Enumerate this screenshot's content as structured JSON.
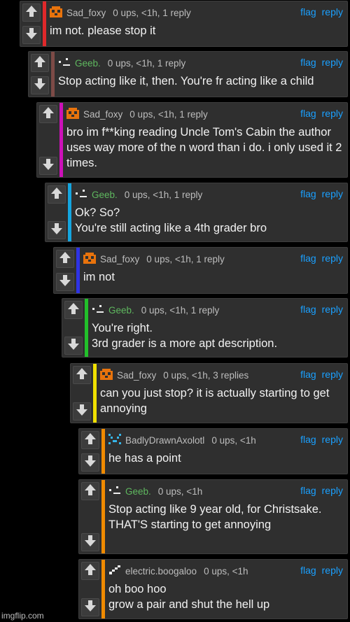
{
  "actions": {
    "flag": "flag",
    "reply": "reply"
  },
  "watermark": "imgflip.com",
  "colors": {
    "background": "#000000",
    "card": "#2f2f2f",
    "link": "#1aa0ff",
    "green_name": "#5fb85f"
  },
  "comments": [
    {
      "user": "Sad_foxy",
      "stats": "0 ups, <1h, 1 reply",
      "text": "im not. please stop it",
      "bar": "#e0282a",
      "avatar": "fox-icon"
    },
    {
      "user": "Geeb.",
      "stats": "0 ups, <1h, 1 reply",
      "text": "Stop acting like it, then. You're fr acting like a child",
      "bar": "#7d4b47",
      "avatar": "face-icon"
    },
    {
      "user": "Sad_foxy",
      "stats": "0 ups, <1h, 1 reply",
      "text": "bro im f**king reading Uncle Tom's Cabin the author uses way more of the n word than i do. i only used it 2 times.",
      "bar": "#cc11b8",
      "avatar": "fox-icon"
    },
    {
      "user": "Geeb.",
      "stats": "0 ups, <1h, 1 reply",
      "text": "Ok? So?\nYou're still acting like a 4th grader bro",
      "bar": "#14a6e0",
      "avatar": "face-icon"
    },
    {
      "user": "Sad_foxy",
      "stats": "0 ups, <1h, 1 reply",
      "text": "im not",
      "bar": "#2e33e6",
      "avatar": "fox-icon"
    },
    {
      "user": "Geeb.",
      "stats": "0 ups, <1h, 1 reply",
      "text": "You're right.\n3rd grader is a more apt description.",
      "bar": "#22c02a",
      "avatar": "face-icon"
    },
    {
      "user": "Sad_foxy",
      "stats": "0 ups, <1h, 3 replies",
      "text": "can you just stop? it is actually starting to get annoying",
      "bar": "#f0e000",
      "avatar": "fox-icon"
    },
    {
      "user": "BadlyDrawnAxolotl",
      "stats": "0 ups, <1h",
      "text": "he has a point",
      "bar": "#f08a00",
      "avatar": "axolotl-icon"
    },
    {
      "user": "Geeb.",
      "stats": "0 ups, <1h",
      "text": "Stop acting like 9 year old, for Christsake.\nTHAT'S starting to get annoying",
      "bar": "#f08a00",
      "avatar": "face-icon"
    },
    {
      "user": "electric.boogaloo",
      "stats": "0 ups, <1h",
      "text": "oh boo hoo\ngrow a pair and shut the hell up",
      "bar": "#f08a00",
      "avatar": "stairs-icon"
    }
  ]
}
